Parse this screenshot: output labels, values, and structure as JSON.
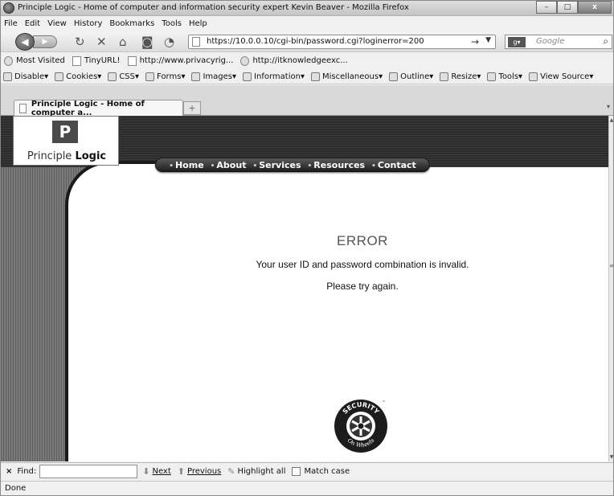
{
  "window": {
    "title": "Principle Logic - Home of computer and information security expert Kevin Beaver - Mozilla Firefox",
    "buttons": {
      "minimize": "–",
      "maximize": "□",
      "close": "x"
    }
  },
  "menu": [
    "File",
    "Edit",
    "View",
    "History",
    "Bookmarks",
    "Tools",
    "Help"
  ],
  "navigation": {
    "url": "https://10.0.0.10/cgi-bin/password.cgi?loginerror=200",
    "search_placeholder": "Google",
    "search_engine_icon": "google-icon"
  },
  "bookmarks": [
    "Most Visited",
    "TinyURL!",
    "http://www.privacyrig...",
    "http://itknowledgeexc..."
  ],
  "dev_toolbar": [
    "Disable",
    "Cookies",
    "CSS",
    "Forms",
    "Images",
    "Information",
    "Miscellaneous",
    "Outline",
    "Resize",
    "Tools",
    "View Source"
  ],
  "tabs": [
    {
      "label": "Principle Logic - Home of computer a...",
      "active": true
    }
  ],
  "site": {
    "logo_mark": "P",
    "logo_text_a": "Principle ",
    "logo_text_b": "Logic",
    "nav": [
      "Home",
      "About",
      "Services",
      "Resources",
      "Contact"
    ]
  },
  "error": {
    "heading": "ERROR",
    "line1": "Your user ID and password combination is invalid.",
    "line2": "Please try again."
  },
  "badge": {
    "top_text": "SECURITY",
    "bottom_text": "On Wheels",
    "tm": "™"
  },
  "findbar": {
    "close": "×",
    "label": "Find:",
    "next": "Next",
    "previous": "Previous",
    "highlight": "Highlight all",
    "match_case": "Match case"
  },
  "status": "Done"
}
